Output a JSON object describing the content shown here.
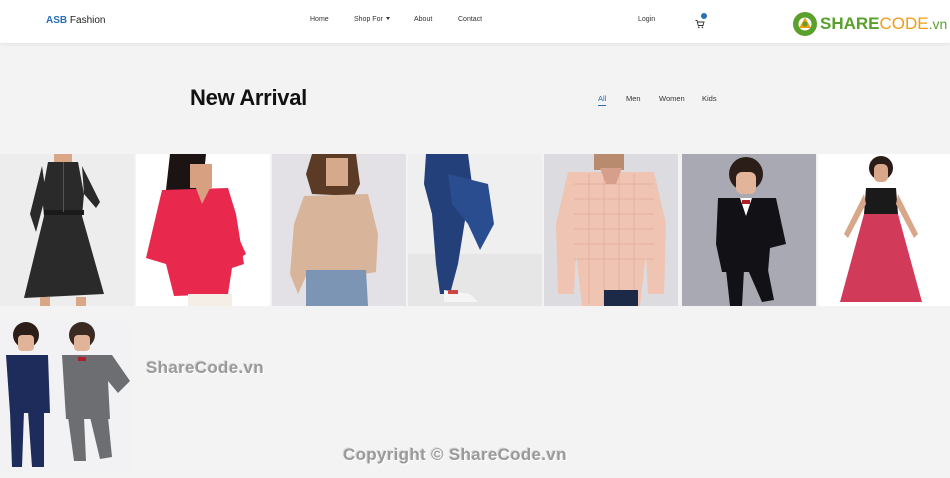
{
  "nav": {
    "brand_a": "ASB",
    "brand_b": " Fashion",
    "home": "Home",
    "shop_for": "Shop For",
    "about": "About",
    "contact": "Contact",
    "login": "Login",
    "cart_icon": "cart-icon"
  },
  "logo": {
    "a": "SHARE",
    "b": "CODE",
    "c": ".vn"
  },
  "section": {
    "title": "New Arrival",
    "filters": [
      "All",
      "Men",
      "Women",
      "Kids"
    ],
    "active_filter": "All"
  },
  "products": [
    {
      "name": "black dress"
    },
    {
      "name": "pink blouse"
    },
    {
      "name": "beige sweater"
    },
    {
      "name": "blue jeans"
    },
    {
      "name": "checked shirt"
    },
    {
      "name": "boy black suit"
    },
    {
      "name": "girl red dress"
    },
    {
      "name": "kids suits"
    }
  ],
  "watermark": {
    "left": "ShareCode.vn",
    "bottom": "Copyright © ShareCode.vn"
  },
  "colors": {
    "accent": "#2a6fb7",
    "brand_green": "#5aa02c",
    "brand_orange": "#f39c12"
  }
}
